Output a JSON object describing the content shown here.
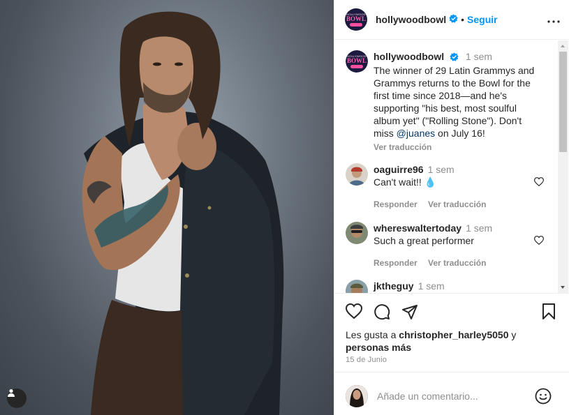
{
  "post": {
    "account": "hollywoodbowl",
    "separator": "•",
    "follow_label": "Seguir",
    "avatar_text": {
      "line1": "HOLLYWOOD",
      "line2": "BOWL"
    }
  },
  "caption": {
    "username": "hollywoodbowl",
    "time": "1 sem",
    "text_before": "The winner of 29 Latin Grammys and Grammys returns to the Bowl for the first time since 2018—and he's supporting \"his best, most soulful album yet\" (\"Rolling Stone\"). Don't miss ",
    "mention": "@juanes",
    "text_after": " on July 16!",
    "translate": "Ver traducción"
  },
  "comments": [
    {
      "username": "oaguirre96",
      "time": "1 sem",
      "text": "Can't wait!! 💧",
      "reply": "Responder",
      "translate": "Ver traducción"
    },
    {
      "username": "whereswaltertoday",
      "time": "1 sem",
      "text": "Such a great performer",
      "reply": "Responder",
      "translate": "Ver traducción"
    },
    {
      "username": "jktheguy",
      "time": "1 sem"
    }
  ],
  "likes": {
    "prefix": "Les gusta a ",
    "user": "christopher_harley5050",
    "conj": " y ",
    "others": "personas más"
  },
  "date": "15 de Junio",
  "add_comment": {
    "placeholder": "Añade un comentario..."
  },
  "icons": {
    "verified": "verified-badge-icon",
    "more": "more-options-icon",
    "like": "heart-icon",
    "comment": "comment-icon",
    "share": "share-icon",
    "save": "bookmark-icon",
    "emoji": "emoji-icon",
    "user_tag": "user-tag-icon"
  },
  "colors": {
    "accent": "#0095f6",
    "mention": "#00376b",
    "muted": "#8e8e8e",
    "text": "#262626"
  }
}
